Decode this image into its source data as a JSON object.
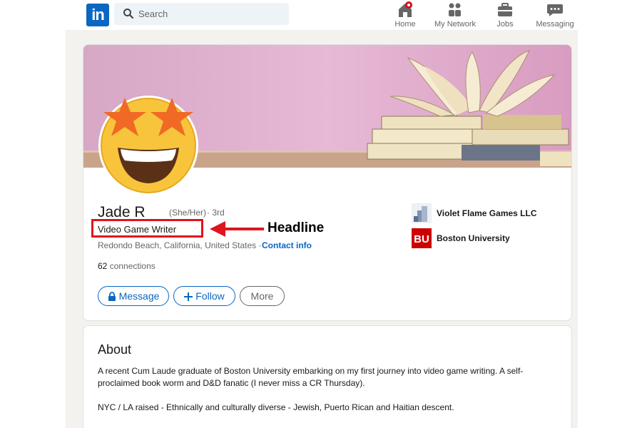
{
  "nav": {
    "logo_text": "in",
    "search_placeholder": "Search",
    "items": [
      {
        "label": "Home",
        "icon": "home-icon"
      },
      {
        "label": "My Network",
        "icon": "network-icon"
      },
      {
        "label": "Jobs",
        "icon": "briefcase-icon"
      },
      {
        "label": "Messaging",
        "icon": "messaging-icon"
      }
    ]
  },
  "profile": {
    "name": "Jade R",
    "pronouns": "(She/Her)",
    "degree": "· 3rd",
    "headline": "Video Game Writer",
    "location": "Redondo Beach, California, United States ·",
    "contact_info": "Contact info",
    "connections_count": "62",
    "connections_label": "connections",
    "buttons": {
      "message": "Message",
      "follow": "Follow",
      "more": "More"
    },
    "organizations": [
      {
        "name": "Violet Flame Games LLC"
      },
      {
        "name": "Boston University",
        "logo_text": "BU"
      }
    ]
  },
  "annotation": {
    "label": "Headline",
    "color": "#e0141e"
  },
  "about": {
    "title": "About",
    "paragraphs": [
      "A recent Cum Laude graduate of Boston University embarking on my first journey into video game writing. A self-proclaimed book worm and D&D fanatic (I never miss a CR Thursday).",
      "NYC / LA raised - Ethnically and culturally diverse - Jewish, Puerto Rican and Haitian descent."
    ]
  },
  "colors": {
    "brand": "#0a66c2",
    "background": "#f3f2ef",
    "annotation": "#e0141e"
  }
}
